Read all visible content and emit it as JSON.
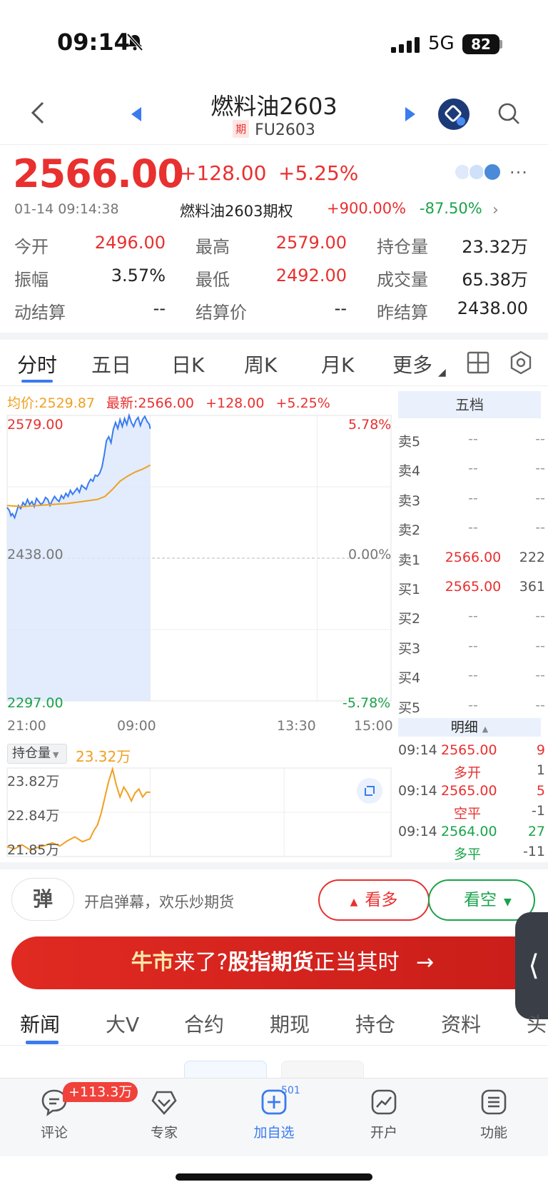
{
  "status": {
    "time": "09:14",
    "network": "5G",
    "battery": "82"
  },
  "header": {
    "title": "燃料油2603",
    "tag": "期",
    "code": "FU2603"
  },
  "quote": {
    "price": "2566.00",
    "change": "+128.00",
    "change_pct": "+5.25%",
    "datetime": "01-14 09:14:38",
    "option_name": "燃料油2603期权",
    "option_up": "+900.00%",
    "option_down": "-87.50%"
  },
  "stats": {
    "r1": [
      {
        "label": "今开",
        "value": "2496.00",
        "color": "#e8302f"
      },
      {
        "label": "最高",
        "value": "2579.00",
        "color": "#e8302f"
      },
      {
        "label": "持仓量",
        "value": "23.32万",
        "color": "#222"
      }
    ],
    "r2": [
      {
        "label": "振幅",
        "value": "3.57%",
        "color": "#222"
      },
      {
        "label": "最低",
        "value": "2492.00",
        "color": "#e8302f"
      },
      {
        "label": "成交量",
        "value": "65.38万",
        "color": "#222"
      }
    ],
    "r3": [
      {
        "label": "动结算",
        "value": "--",
        "color": "#222"
      },
      {
        "label": "结算价",
        "value": "--",
        "color": "#222"
      },
      {
        "label": "昨结算",
        "value": "2438.00",
        "color": "#222"
      }
    ]
  },
  "chart_tabs": [
    "分时",
    "五日",
    "日K",
    "周K",
    "月K",
    "更多"
  ],
  "info_line": {
    "avg": "均价:2529.87",
    "latest": "最新:2566.00",
    "chg": "+128.00",
    "pct": "+5.25%"
  },
  "chart_data": [
    {
      "type": "line",
      "y_left_ticks": [
        "2579.00",
        "2438.00",
        "2297.00"
      ],
      "y_right_ticks": [
        "5.78%",
        "0.00%",
        "-5.78%"
      ],
      "x_ticks": [
        "21:00",
        "09:00",
        "13:30",
        "15:00"
      ],
      "ylim": [
        2297,
        2579
      ],
      "series": [
        {
          "name": "最新",
          "color": "#3a7bef",
          "x": [
            0,
            3,
            5,
            7,
            10,
            13,
            15,
            18,
            21,
            24,
            27,
            30,
            33,
            36,
            39,
            42,
            45,
            48,
            51,
            54,
            57,
            60,
            63,
            66,
            69,
            72,
            75,
            78,
            81,
            84,
            87,
            90,
            93,
            96,
            99,
            102,
            105,
            108,
            111,
            114,
            117,
            120,
            123,
            126,
            129,
            132,
            135,
            138,
            141,
            144,
            147,
            150,
            153,
            156,
            159,
            162,
            165,
            168,
            171,
            174,
            177,
            180,
            183,
            186,
            189,
            190
          ],
          "y": [
            2488,
            2485,
            2480,
            2482,
            2478,
            2485,
            2490,
            2487,
            2493,
            2490,
            2496,
            2491,
            2494,
            2489,
            2497,
            2494,
            2491,
            2493,
            2498,
            2496,
            2490,
            2495,
            2499,
            2496,
            2494,
            2500,
            2497,
            2502,
            2499,
            2505,
            2501,
            2504,
            2507,
            2503,
            2510,
            2508,
            2506,
            2512,
            2516,
            2514,
            2520,
            2519,
            2522,
            2528,
            2540,
            2554,
            2558,
            2552,
            2565,
            2572,
            2566,
            2575,
            2568,
            2576,
            2570,
            2579,
            2572,
            2568,
            2574,
            2577,
            2569,
            2575,
            2578,
            2573,
            2570,
            2566
          ]
        },
        {
          "name": "均价",
          "color": "#f0a020",
          "x": [
            0,
            20,
            40,
            60,
            80,
            100,
            120,
            130,
            140,
            150,
            160,
            170,
            180,
            190
          ],
          "y": [
            2490,
            2489,
            2490,
            2491,
            2492,
            2494,
            2496,
            2499,
            2506,
            2514,
            2519,
            2523,
            2526,
            2529.87
          ]
        }
      ]
    },
    {
      "type": "line",
      "y_ticks": [
        "23.82万",
        "22.84万",
        "21.85万"
      ],
      "ylim": [
        21.85,
        23.82
      ],
      "series": [
        {
          "name": "持仓量",
          "color": "#f0a020",
          "x": [
            0,
            10,
            20,
            30,
            40,
            50,
            60,
            70,
            80,
            90,
            100,
            110,
            115,
            120,
            125,
            130,
            135,
            140,
            145,
            150,
            155,
            160,
            165,
            170,
            175,
            180,
            185,
            190
          ],
          "y": [
            21.95,
            21.9,
            22.0,
            21.88,
            21.93,
            21.98,
            22.05,
            21.97,
            22.1,
            22.2,
            22.08,
            22.15,
            22.35,
            22.5,
            22.8,
            23.2,
            23.6,
            23.9,
            23.5,
            23.2,
            23.45,
            23.3,
            23.1,
            23.3,
            23.4,
            23.2,
            23.32,
            23.32
          ]
        }
      ]
    }
  ],
  "order_book": {
    "title": "五档",
    "rows": [
      {
        "label": "卖5",
        "price": "--",
        "vol": "--"
      },
      {
        "label": "卖4",
        "price": "--",
        "vol": "--"
      },
      {
        "label": "卖3",
        "price": "--",
        "vol": "--"
      },
      {
        "label": "卖2",
        "price": "--",
        "vol": "--"
      },
      {
        "label": "卖1",
        "price": "2566.00",
        "vol": "222"
      },
      {
        "label": "买1",
        "price": "2565.00",
        "vol": "361"
      },
      {
        "label": "买2",
        "price": "--",
        "vol": "--"
      },
      {
        "label": "买3",
        "price": "--",
        "vol": "--"
      },
      {
        "label": "买4",
        "price": "--",
        "vol": "--"
      },
      {
        "label": "买5",
        "price": "--",
        "vol": "--"
      }
    ]
  },
  "oi_panel": {
    "label": "持仓量",
    "value": "23.32万"
  },
  "detail": {
    "title": "明细",
    "rows": [
      {
        "time": "09:14",
        "price": "2565.00",
        "vol": "9",
        "type": "多开",
        "delta": "1",
        "tcolor": "#e8302f",
        "vcolor": "#e8302f"
      },
      {
        "time": "09:14",
        "price": "2565.00",
        "vol": "5",
        "type": "空平",
        "delta": "-1",
        "tcolor": "#e8302f",
        "vcolor": "#e8302f"
      },
      {
        "time": "09:14",
        "price": "2564.00",
        "vol": "27",
        "type": "多平",
        "delta": "-11",
        "tcolor": "#1aa34a",
        "vcolor": "#1aa34a"
      }
    ]
  },
  "danmu": {
    "icon": "弹",
    "text": "开启弹幕，欢乐炒期货"
  },
  "vote": {
    "up": "看多",
    "down": "看空"
  },
  "banner": {
    "p1": "牛市",
    "p2": "来了?",
    "p3": "股指期货",
    "p4": "正当其时",
    "arrow": "→"
  },
  "news_tabs": [
    "新闻",
    "大V",
    "合约",
    "期现",
    "持仓",
    "资料",
    "头"
  ],
  "nav": {
    "items": [
      "评论",
      "专家",
      "加自选",
      "开户",
      "功能"
    ],
    "badge": "+113.3万",
    "add_count": "501"
  }
}
